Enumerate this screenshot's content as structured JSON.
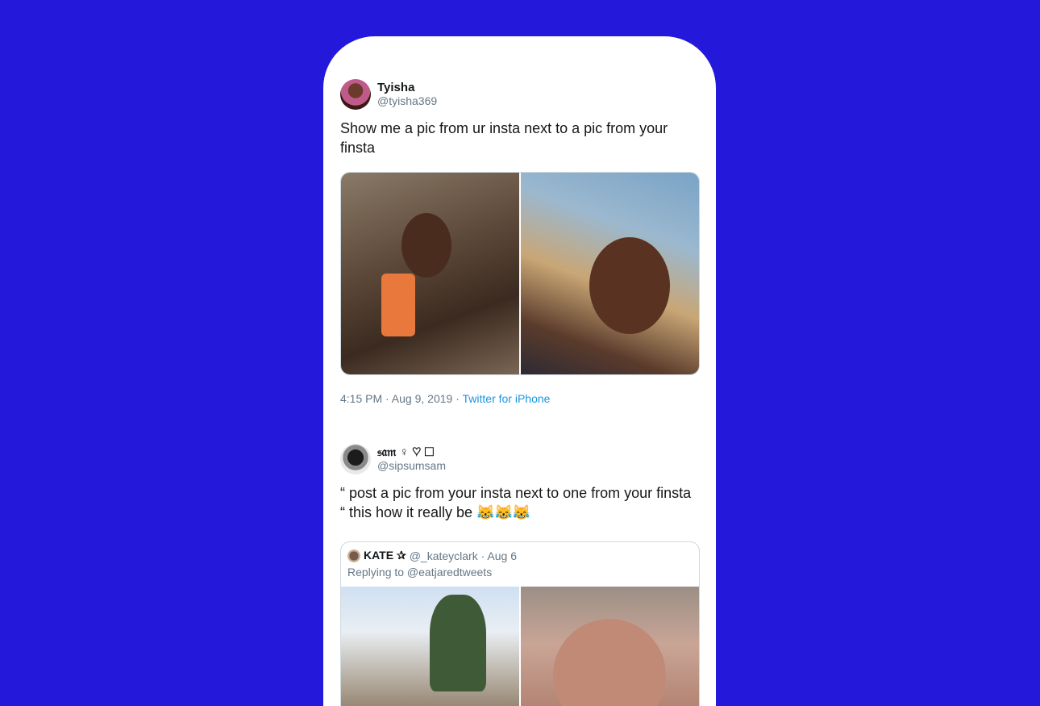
{
  "tweet1": {
    "display_name": "Tyisha",
    "handle": "@tyisha369",
    "text": "Show me a pic from ur insta next to a pic from your finsta",
    "timestamp": "4:15 PM · Aug 9, 2019 ·",
    "source": "Twitter for iPhone"
  },
  "tweet2": {
    "display_name": "𝔰𝔞𝔪 ♀ ♡ ☐",
    "handle": "@sipsumsam",
    "text": "“ post a pic from your insta next to one from your finsta “ this how it really be 😹😹😹",
    "quoted": {
      "display_name": "KATE ✰",
      "handle_date": "@_kateyclark · Aug 6",
      "replying_to": "Replying to @eatjaredtweets"
    }
  },
  "colors": {
    "background": "#2419da",
    "link": "#1b95e0",
    "secondary_text": "#657786"
  }
}
